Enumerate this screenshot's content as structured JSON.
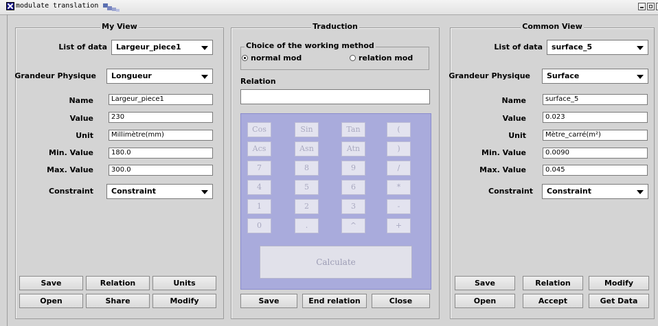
{
  "window": {
    "title": "modulate translation"
  },
  "left": {
    "title": "My View",
    "list_label": "List of data",
    "list_value": "Largeur_piece1",
    "grandeur_label": "Grandeur Physique",
    "grandeur_value": "Longueur",
    "fields": [
      {
        "label": "Name",
        "value": "Largeur_piece1"
      },
      {
        "label": "Value",
        "value": "230"
      },
      {
        "label": "Unit",
        "value": "Millimètre(mm)"
      },
      {
        "label": "Min. Value",
        "value": "180.0"
      },
      {
        "label": "Max. Value",
        "value": "300.0"
      }
    ],
    "constraint_label": "Constraint",
    "constraint_value": "Constraint",
    "buttons": {
      "save": "Save",
      "relation": "Relation",
      "units": "Units",
      "open": "Open",
      "share": "Share",
      "modify": "Modify"
    }
  },
  "middle": {
    "title": "Traduction",
    "method_title": "Choice of the working method",
    "method_options": [
      "normal mod",
      "relation mod"
    ],
    "method_selected": "normal mod",
    "relation_label": "Relation",
    "relation_value": "",
    "keys": [
      "Cos",
      "Sin",
      "Tan",
      "(",
      "Acs",
      "Asn",
      "Atn",
      ")",
      "7",
      "8",
      "9",
      "/",
      "4",
      "5",
      "6",
      "*",
      "1",
      "2",
      "3",
      "-",
      "0",
      ".",
      "^",
      "+"
    ],
    "calculate": "Calculate",
    "buttons": {
      "save": "Save",
      "end_relation": "End relation",
      "close": "Close"
    }
  },
  "right": {
    "title": "Common View",
    "list_label": "List of data",
    "list_value": "surface_5",
    "grandeur_label": "Grandeur Physique",
    "grandeur_value": "Surface",
    "fields": [
      {
        "label": "Name",
        "value": "surface_5"
      },
      {
        "label": "Value",
        "value": "0.023"
      },
      {
        "label": "Unit",
        "value": "Mètre_carré(m²)"
      },
      {
        "label": "Min. Value",
        "value": "0.0090"
      },
      {
        "label": "Max. Value",
        "value": "0.045"
      }
    ],
    "constraint_label": "Constraint",
    "constraint_value": "Constraint",
    "buttons": {
      "save": "Save",
      "relation": "Relation",
      "modify": "Modify",
      "open": "Open",
      "accept": "Accept",
      "get_data": "Get Data"
    }
  }
}
